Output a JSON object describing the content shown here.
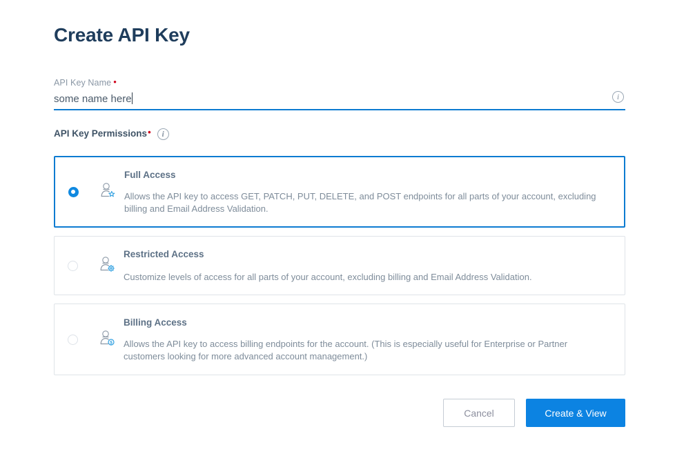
{
  "page": {
    "title": "Create API Key",
    "colors": {
      "accent_blue": "#0c83e2",
      "title_navy": "#1f3d5c",
      "required_red": "#d0021b",
      "card_border": "#dfe3e8",
      "selected_border": "#0c7bd1",
      "body_text": "#7e8c9a"
    }
  },
  "name_field": {
    "label": "API Key Name",
    "required_marker": "•",
    "value": "some name here",
    "placeholder": "",
    "info_icon": "info-circle-icon"
  },
  "permissions": {
    "label": "API Key Permissions",
    "required_marker": "•",
    "info_icon": "info-circle-icon",
    "selected": "full_access",
    "options": [
      {
        "id": "full_access",
        "title": "Full Access",
        "description": "Allows the API key to access GET, PATCH, PUT, DELETE, and POST endpoints for all parts of your account, excluding billing and Email Address Validation.",
        "icon": "user-star-icon",
        "selected": true
      },
      {
        "id": "restricted_access",
        "title": "Restricted Access",
        "description": "Customize levels of access for all parts of your account, excluding billing and Email Address Validation.",
        "icon": "user-gear-icon",
        "selected": false
      },
      {
        "id": "billing_access",
        "title": "Billing Access",
        "description": "Allows the API key to access billing endpoints for the account. (This is especially useful for Enterprise or Partner customers looking for more advanced account management.)",
        "icon": "user-dollar-icon",
        "selected": false
      }
    ]
  },
  "footer": {
    "cancel_label": "Cancel",
    "submit_label": "Create & View"
  }
}
